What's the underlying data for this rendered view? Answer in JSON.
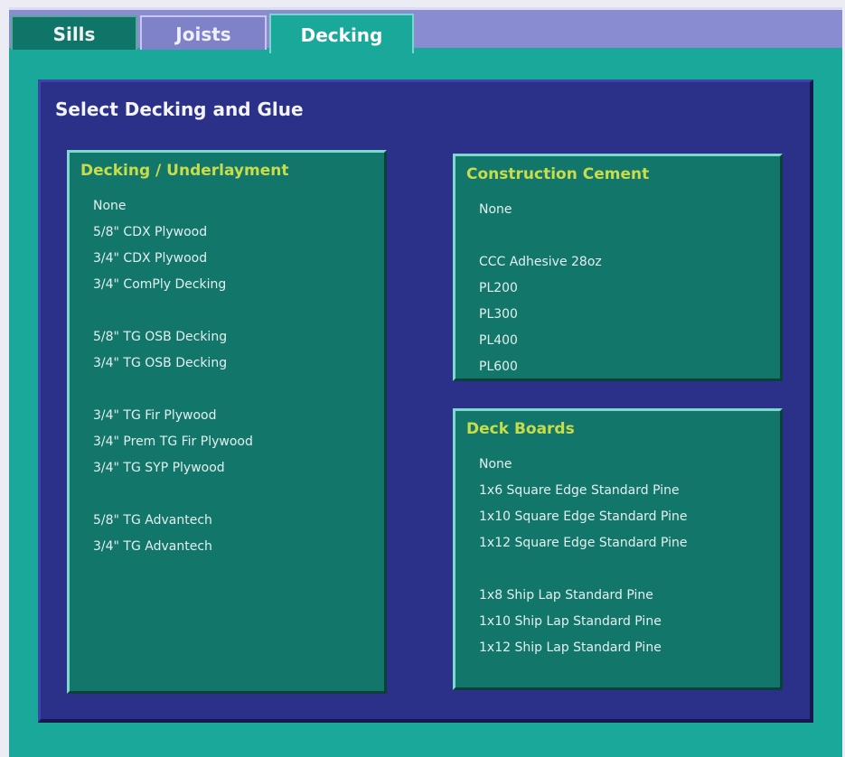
{
  "tabs": {
    "sills": "Sills",
    "joists": "Joists",
    "decking": "Decking",
    "active": "Decking"
  },
  "panel": {
    "title": "Select Decking and Glue"
  },
  "groups": {
    "decking": {
      "title": "Decking / Underlayment",
      "items": [
        "None",
        "5/8\" CDX Plywood",
        "3/4\" CDX Plywood",
        "3/4\" ComPly Decking",
        "",
        "5/8\" TG OSB Decking",
        "3/4\" TG OSB Decking",
        "",
        "3/4\" TG Fir Plywood",
        "3/4\" Prem TG Fir Plywood",
        "3/4\" TG SYP  Plywood",
        "",
        "5/8\" TG Advantech",
        "3/4\" TG Advantech"
      ]
    },
    "cement": {
      "title": "Construction Cement",
      "items": [
        "None",
        "",
        "CCC Adhesive 28oz",
        "PL200",
        "PL300",
        "PL400",
        "PL600"
      ]
    },
    "boards": {
      "title": "Deck Boards",
      "items": [
        "None",
        "1x6 Square Edge Standard Pine",
        "1x10 Square Edge Standard Pine",
        "1x12 Square Edge Standard Pine",
        "",
        "1x8 Ship Lap Standard Pine",
        "1x10 Ship Lap Standard Pine",
        "1x12 Ship Lap Standard Pine"
      ]
    }
  }
}
